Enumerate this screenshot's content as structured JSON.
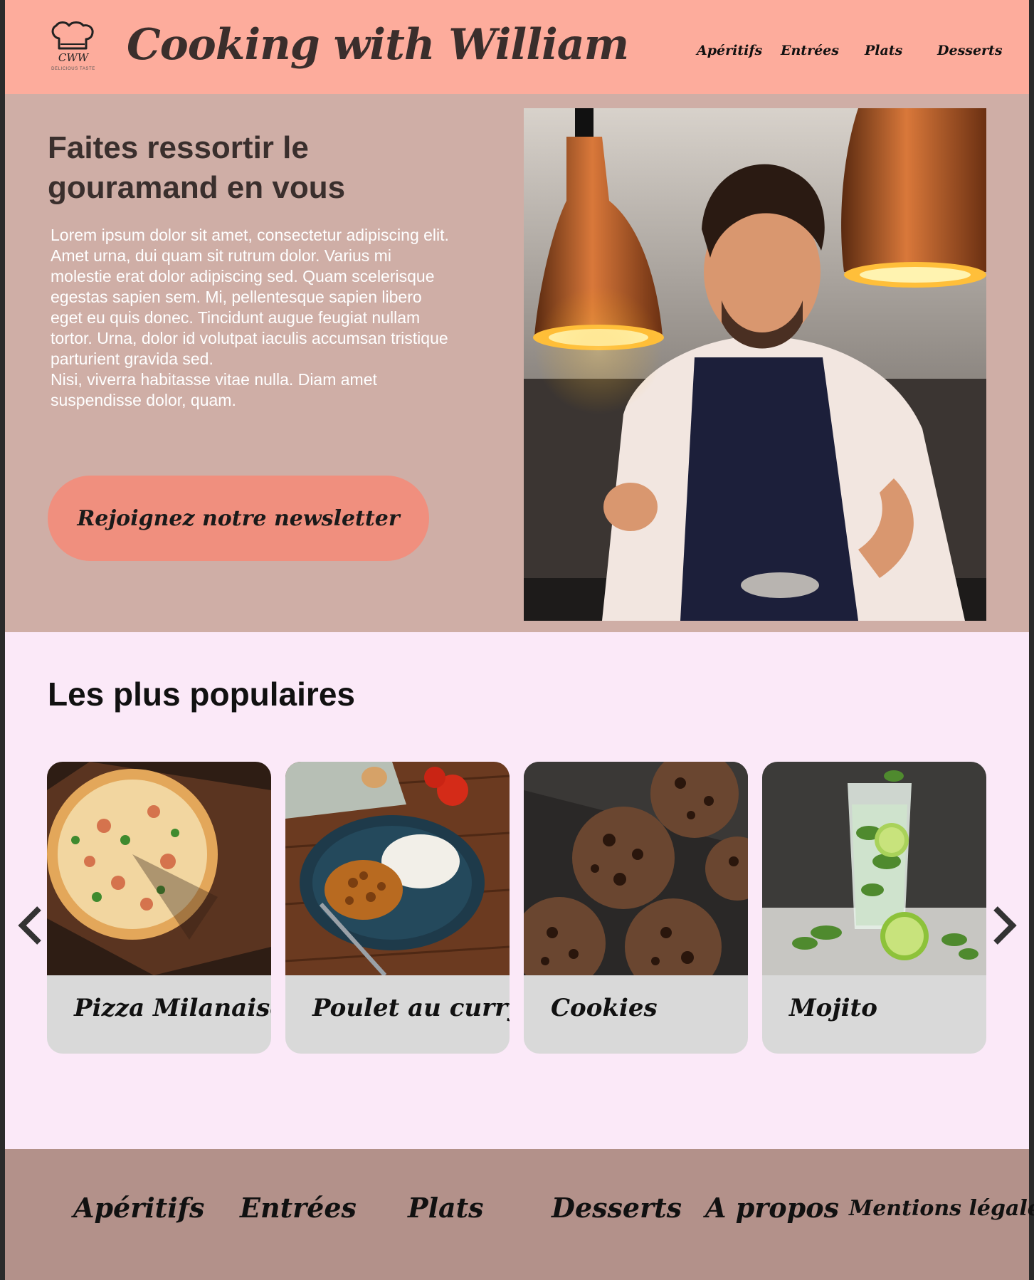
{
  "header": {
    "logo_text": "CWW",
    "logo_tagline": "DELICIOUS TASTE",
    "site_title": "Cooking with William",
    "nav": [
      "Apéritifs",
      "Entrées",
      "Plats",
      "Desserts"
    ]
  },
  "hero": {
    "title": "Faites ressortir le gouramand en vous",
    "paragraph_1": "Lorem ipsum dolor sit amet, consectetur adipiscing elit. Amet urna, dui quam sit rutrum dolor. Varius mi molestie erat dolor adipiscing sed. Quam scelerisque egestas sapien sem. Mi, pellentesque sapien libero eget eu quis donec. Tincidunt augue feugiat nullam tortor. Urna, dolor id volutpat iaculis accumsan tristique parturient gravida sed.",
    "paragraph_2": "Nisi, viverra habitasse vitae nulla. Diam amet suspendisse dolor, quam.",
    "cta_label": "Rejoignez notre newsletter"
  },
  "popular": {
    "title": "Les plus populaires",
    "cards": [
      {
        "label": "Pizza Milanaise",
        "icon": "pizza-photo"
      },
      {
        "label": "Poulet au curry",
        "icon": "curry-photo"
      },
      {
        "label": "Cookies",
        "icon": "cookies-photo"
      },
      {
        "label": "Mojito",
        "icon": "mojito-photo"
      }
    ],
    "prev_icon": "chevron-left-icon",
    "next_icon": "chevron-right-icon"
  },
  "footer": {
    "nav": [
      "Apéritifs",
      "Entrées",
      "Plats",
      "Desserts",
      "A propos",
      "Mentions légales"
    ]
  },
  "colors": {
    "header_bg": "#fdac9c",
    "hero_bg": "#cfaea6",
    "cta_bg": "#f08f7e",
    "popular_bg": "#fbe9f8",
    "card_bg": "#d9d9d9",
    "footer_bg": "#b3918a"
  }
}
